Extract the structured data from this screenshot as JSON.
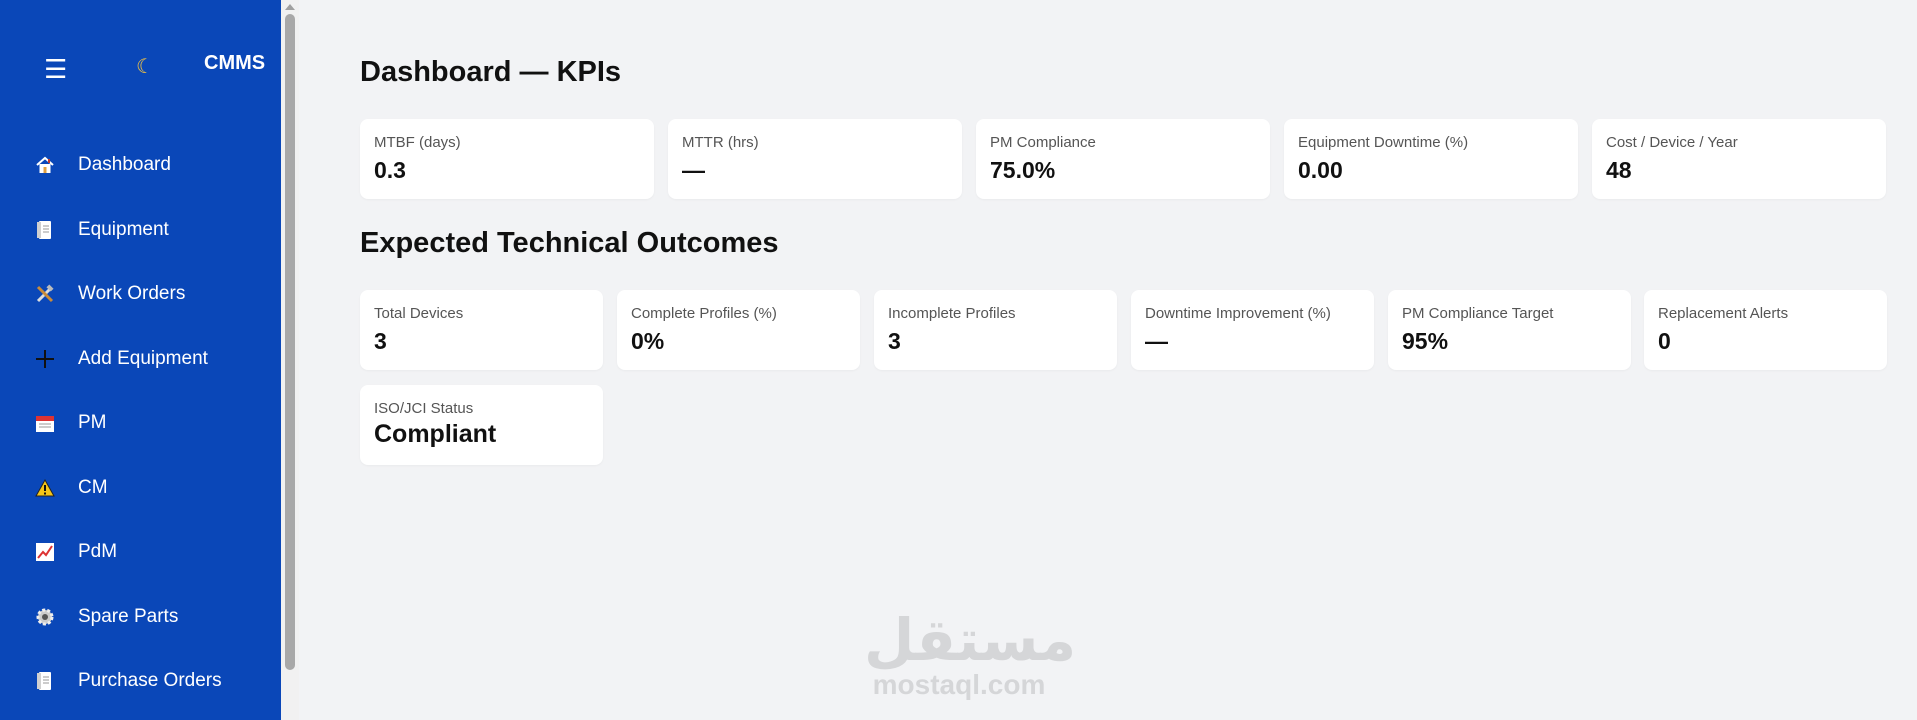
{
  "sidebar": {
    "menu_icon": "hamburger-icon",
    "theme_icon": "moon-icon",
    "brand": "CMMS",
    "items": [
      {
        "label": "Dashboard",
        "icon": "house-icon"
      },
      {
        "label": "Equipment",
        "icon": "document-icon"
      },
      {
        "label": "Work Orders",
        "icon": "tools-icon"
      },
      {
        "label": "Add Equipment",
        "icon": "plus-icon"
      },
      {
        "label": "PM",
        "icon": "calendar-icon"
      },
      {
        "label": "CM",
        "icon": "warning-icon"
      },
      {
        "label": "PdM",
        "icon": "chart-icon"
      },
      {
        "label": "Spare Parts",
        "icon": "gear-icon"
      },
      {
        "label": "Purchase Orders",
        "icon": "document-icon"
      }
    ],
    "colors": {
      "background": "#0a47b8",
      "text": "#ffffff"
    }
  },
  "kpis": {
    "title": "Dashboard — KPIs",
    "cards": [
      {
        "label": "MTBF (days)",
        "value": "0.3"
      },
      {
        "label": "MTTR (hrs)",
        "value": "—"
      },
      {
        "label": "PM Compliance",
        "value": "75.0%"
      },
      {
        "label": "Equipment Downtime (%)",
        "value": "0.00"
      },
      {
        "label": "Cost / Device / Year",
        "value": "48"
      }
    ]
  },
  "outcomes": {
    "title": "Expected Technical Outcomes",
    "cards": [
      {
        "label": "Total Devices",
        "value": "3"
      },
      {
        "label": "Complete Profiles (%)",
        "value": "0%"
      },
      {
        "label": "Incomplete Profiles",
        "value": "3"
      },
      {
        "label": "Downtime Improvement (%)",
        "value": "—"
      },
      {
        "label": "PM Compliance Target",
        "value": "95%"
      },
      {
        "label": "Replacement Alerts",
        "value": "0"
      },
      {
        "label": "ISO/JCI Status",
        "value": "Compliant"
      }
    ]
  },
  "watermark": {
    "arabic": "مستقل",
    "latin": "mostaql.com"
  },
  "colors": {
    "page_background": "#f2f3f5",
    "card_background": "#ffffff"
  }
}
